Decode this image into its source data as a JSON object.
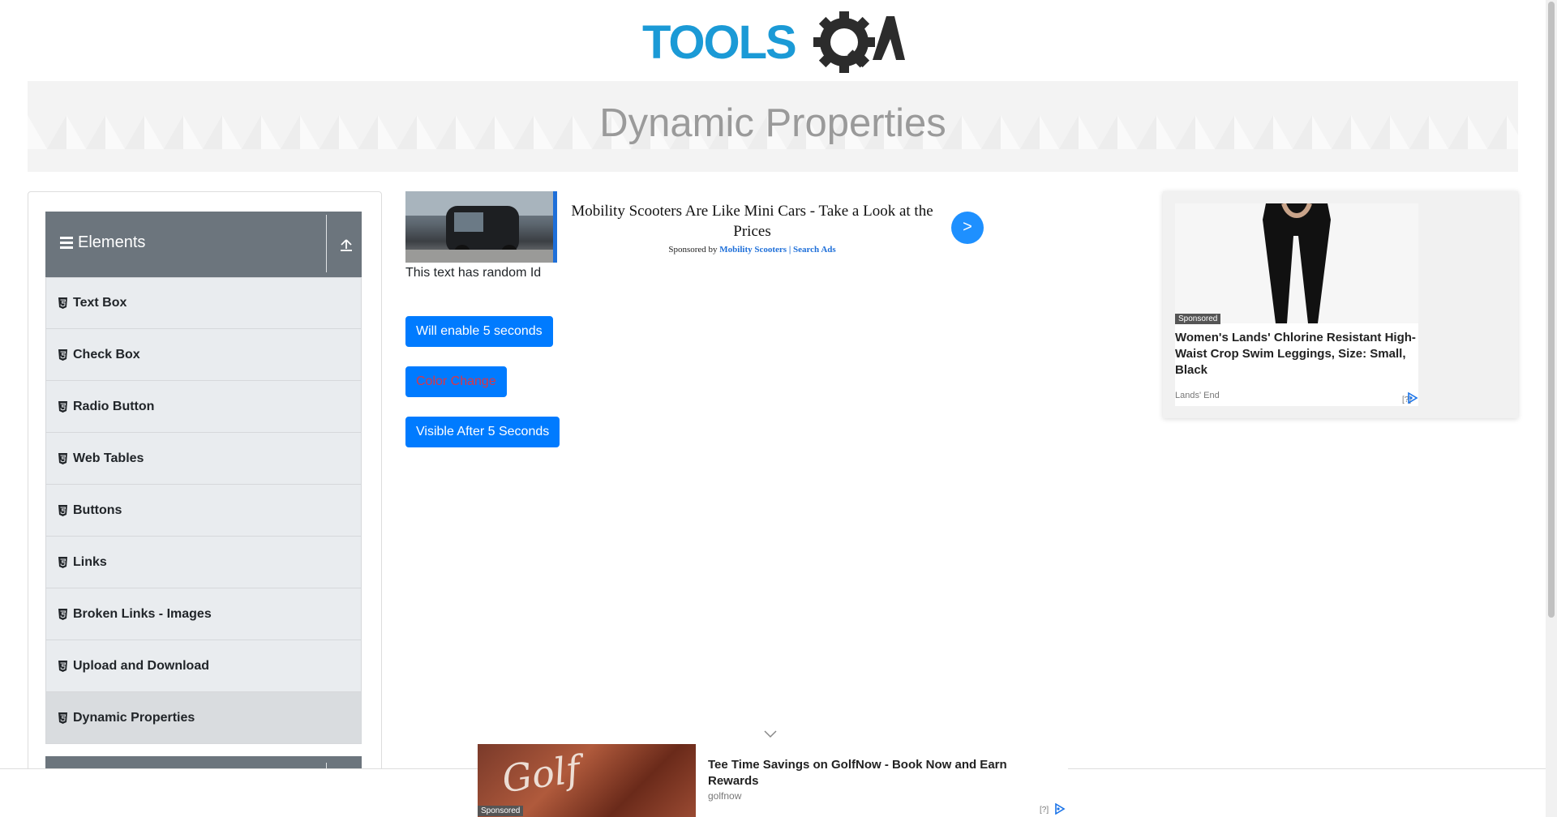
{
  "header": {
    "logo_text": "TOOLS QA",
    "page_title": "Dynamic Properties"
  },
  "sidebar": {
    "group_title": "Elements",
    "items": [
      {
        "label": "Text Box"
      },
      {
        "label": "Check Box"
      },
      {
        "label": "Radio Button"
      },
      {
        "label": "Web Tables"
      },
      {
        "label": "Buttons"
      },
      {
        "label": "Links"
      },
      {
        "label": "Broken Links - Images"
      },
      {
        "label": "Upload and Download"
      },
      {
        "label": "Dynamic Properties",
        "active": true
      }
    ]
  },
  "main": {
    "random_id_text": "This text has random Id",
    "enable_button": "Will enable 5 seconds",
    "color_button": "Color Change",
    "visible_button": "Visible After 5 Seconds"
  },
  "ads": {
    "top": {
      "title": "Mobility Scooters Are Like Mini Cars - Take a Look at the Prices",
      "sponsored_prefix": "Sponsored by",
      "sponsor": "Mobility Scooters | Search Ads",
      "go_label": ">"
    },
    "right": {
      "tag": "Sponsored",
      "title": "Women's Lands' Chlorine Resistant High-Waist Crop Swim Leggings, Size: Small, Black",
      "brand": "Lands' End",
      "help": "[?]"
    },
    "bottom": {
      "tag": "Sponsored",
      "image_text": "Golf",
      "title": "Tee Time Savings on GolfNow - Book Now and Earn Rewards",
      "brand": "golfnow",
      "help": "[?]"
    }
  },
  "colors": {
    "primary_button": "#007bff",
    "sidebar_header": "#6c757d",
    "logo_blue": "#1b9ad6",
    "logo_dark": "#2c2c2c"
  }
}
